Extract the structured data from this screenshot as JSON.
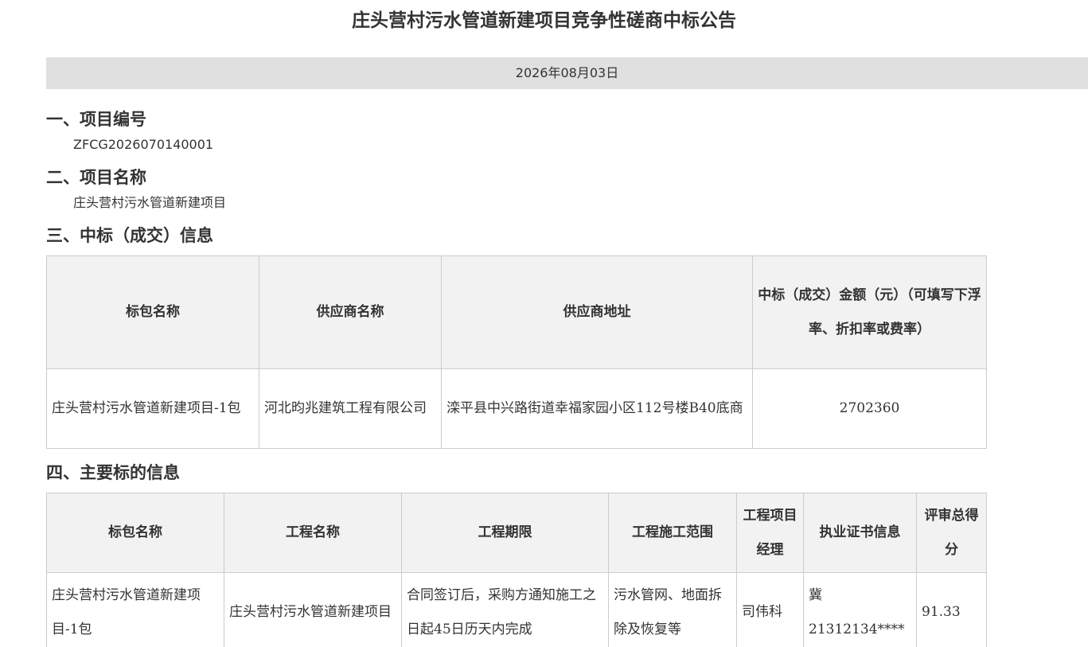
{
  "title": "庄头营村污水管道新建项目竞争性磋商中标公告",
  "date": "2026年08月03日",
  "sections": {
    "project_number": {
      "heading": "一、项目编号",
      "value": "ZFCG2026070140001"
    },
    "project_name": {
      "heading": "二、项目名称",
      "value": "庄头营村污水管道新建项目"
    },
    "award_info": {
      "heading": "三、中标（成交）信息",
      "columns": [
        "标包名称",
        "供应商名称",
        "供应商地址",
        "中标（成交）金额（元）（可填写下浮率、折扣率或费率）"
      ],
      "rows": [
        {
          "package": "庄头营村污水管道新建项目-1包",
          "supplier": "河北昀兆建筑工程有限公司",
          "address": "滦平县中兴路街道幸福家园小区112号楼B40底商",
          "amount": "2702360"
        }
      ]
    },
    "bidder_info": {
      "heading": "四、主要标的信息",
      "columns": [
        "标包名称",
        "工程名称",
        "工程期限",
        "工程施工范围",
        "工程项目经理",
        "执业证书信息",
        "评审总得分"
      ],
      "rows": [
        {
          "package": "庄头营村污水管道新建项目-1包",
          "project": "庄头营村污水管道新建项目",
          "period": "合同签订后，采购方通知施工之日起45日历天内完成",
          "scope": "污水管网、地面拆除及恢复等",
          "manager": "司伟科",
          "certificate": "冀21312134****",
          "score": "91.33"
        }
      ]
    }
  }
}
